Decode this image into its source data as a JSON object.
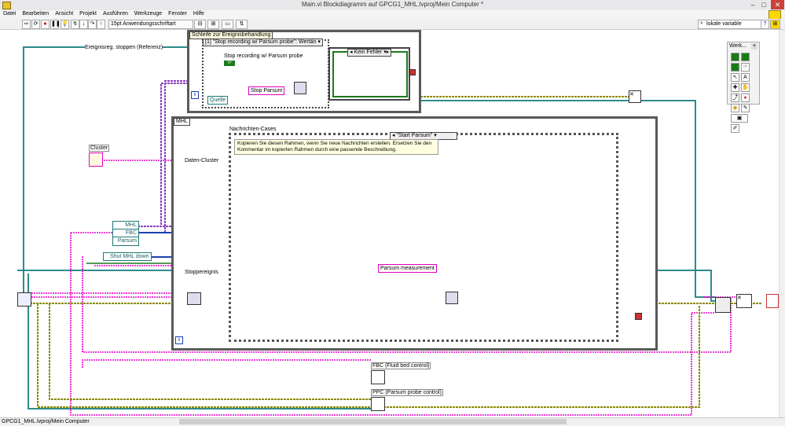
{
  "window": {
    "title": "Main.vi Blockdiagramm auf GPCG1_MHL.lvproj/Mein Computer *",
    "buttons": {
      "minimize": "–",
      "maximize": "□",
      "close": "✕"
    }
  },
  "menu": [
    "Datei",
    "Bearbeiten",
    "Ansicht",
    "Projekt",
    "Ausführen",
    "Werkzeuge",
    "Fenster",
    "Hilfe"
  ],
  "toolbar": {
    "font_select": "15pt Anwendungsschriftart",
    "search_placeholder": "lokale variable"
  },
  "diagram": {
    "event_loop": {
      "title": "Schleife zur Ereignisbehandlung",
      "case_selector": "\"Stop recording w/ Parsum probe\": Wertän",
      "case_index": "[1]",
      "inner_label": "Stop recording w/ Parsum probe",
      "inner_tf": "TF",
      "error_case": "Kein Fehler",
      "quelle": "Quelle",
      "stop_parsum": "Stop Parsum"
    },
    "main_loop": {
      "title": "MHL",
      "messages_title": "Nachrichten-Cases",
      "case_selector": "\"Start Parsum\"",
      "comment": "Kopieren Sie diesen Rahmen, wenn Sie neue Nachrichten erstellen.  Ersetzen Sie den Kommentar im kopierten Rahmen durch eine passende Beschreibung.",
      "parsum_measurement": "Parsum measurement",
      "daten_cluster": "Daten-Cluster",
      "stoppereignis": "Stoppereignis"
    },
    "labels": {
      "ereignis_stop": "Ereignisreg. stoppen (Referenz)",
      "cluster": "Cluster",
      "shut_down": "Shut MHL down",
      "fbc_vi": "FBC (Fluid bed control)",
      "ppc_vi": "PPC (Parsum probe control)"
    },
    "enum_items": [
      "MHL",
      "FBC",
      "Parsum"
    ]
  },
  "palette": {
    "title": "Werk...",
    "close": "+"
  },
  "statusbar": {
    "text": "GPCG1_MHL.lvproj/Mein Computer"
  },
  "colors": {
    "pink_wire": "#e600c8",
    "teal_wire": "#2e8b8b",
    "green_wire": "#1a7a1a",
    "olive_wire": "#8a8a00",
    "blue_wire": "#1b3fb0",
    "purple_wire": "#7a3fb0",
    "structure_gray": "#5a5a5a"
  },
  "icons": [
    "labview-app-icon",
    "run-arrow-icon",
    "run-continuous-icon",
    "abort-icon",
    "pause-icon",
    "highlight-icon",
    "search-icon",
    "help-icon",
    "close-case-icon"
  ]
}
